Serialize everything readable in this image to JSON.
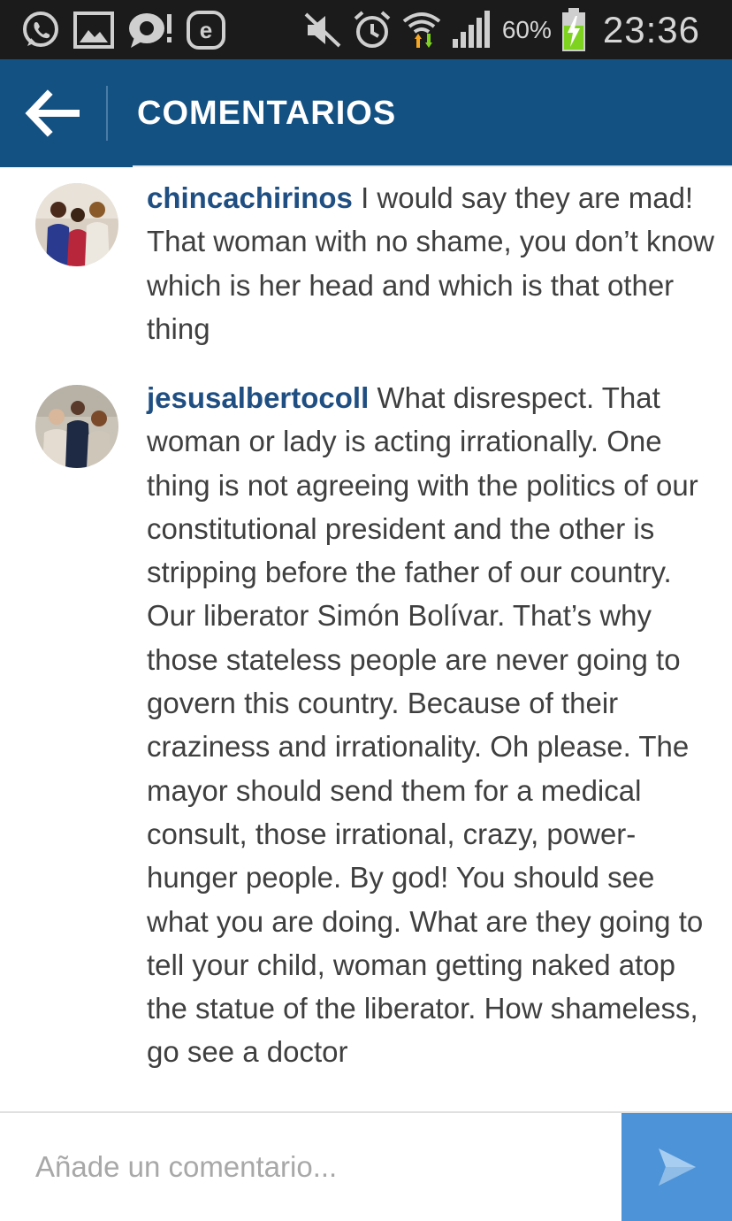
{
  "status_bar": {
    "battery_percent": "60%",
    "time": "23:36",
    "left_icons": [
      "whatsapp-icon",
      "gallery-icon",
      "chat-icon",
      "e-app-icon"
    ],
    "right_icons": [
      "mute-icon",
      "alarm-icon",
      "wifi-icon",
      "signal-icon",
      "battery-charging-icon"
    ]
  },
  "app_bar": {
    "title": "COMENTARIOS",
    "back_icon": "arrow-left-icon"
  },
  "comments": [
    {
      "username": "chincachirinos",
      "text": "I would say they are mad! That woman with no shame, you don’t know which is her head and which is that other thing"
    },
    {
      "username": "jesusalbertocoll",
      "text": "What disrespect. That woman or lady is acting irrationally. One thing is not agreeing with the politics of our constitutional president and the other is stripping before the father of our country. Our liberator Simón Bolívar. That’s why those stateless people are never going to govern this country. Because of their craziness and irrationality. Oh please. The mayor should send them for a medical consult, those irrational, crazy, power-hunger people. By god! You should see what you are doing. What are they going to tell your child, woman getting naked atop the statue of the liberator. How shameless, go see a doctor"
    }
  ],
  "comment_input": {
    "placeholder": "Añade un comentario...",
    "value": ""
  },
  "send_button": {
    "icon": "send-icon"
  },
  "colors": {
    "status_bar_bg": "#1b1b1b",
    "app_bar_bg": "#145183",
    "username": "#1f4f82",
    "comment_text": "#3f3f3f",
    "send_button_bg": "#4d93d7",
    "battery_fill": "#7ed321"
  }
}
